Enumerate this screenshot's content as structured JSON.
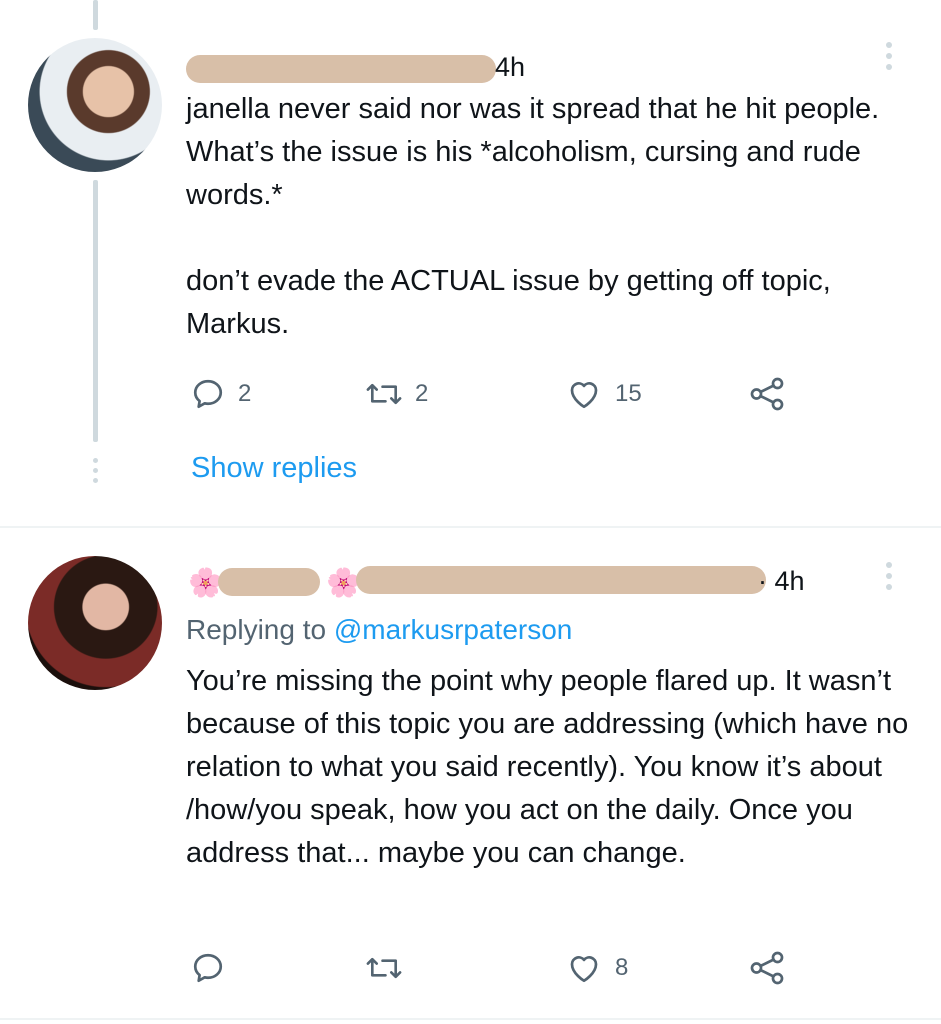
{
  "tweets": [
    {
      "time": "4h",
      "text": "janella never said nor was it spread that he hit people. What’s the issue is his *alcoholism, cursing and rude words.*\n\ndon’t evade the ACTUAL issue by getting off topic, Markus.",
      "counts": {
        "replies": "2",
        "retweets": "2",
        "likes": "15"
      },
      "show_replies": "Show replies"
    },
    {
      "time": "· 4h",
      "replying_prefix": "Replying to ",
      "replying_handle": "@markusrpaterson",
      "flower": "🌸",
      "text": "You’re missing the point why people flared up. It wasn’t because of this topic you are addressing (which have no relation to what you said recently). You know it’s about /how/you speak, how you act on the daily. Once you address that... maybe you can change.",
      "counts": {
        "replies": "",
        "retweets": "",
        "likes": "8"
      }
    }
  ],
  "colors": {
    "link": "#1d9bf0",
    "muted": "#536471",
    "thread": "#cfd9de",
    "redaction": "#d8bfa8"
  }
}
